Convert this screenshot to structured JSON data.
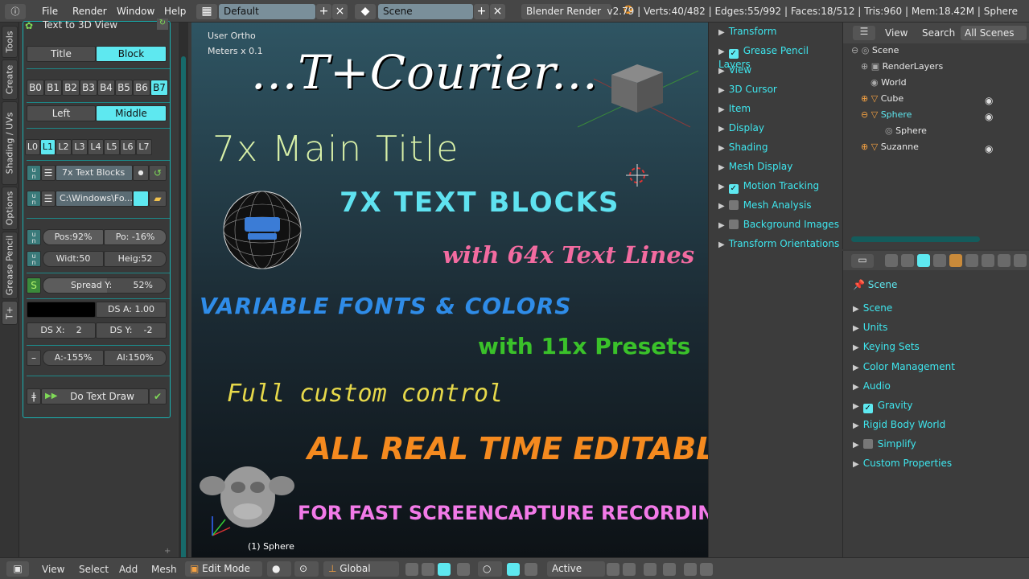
{
  "topbar": {
    "menus": [
      "File",
      "Render",
      "Window",
      "Help"
    ],
    "layout": "Default",
    "scene": "Scene",
    "engine": "Blender Render",
    "status": "v2.79 | Verts:40/482 | Edges:55/992 | Faces:18/512 | Tris:960 | Mem:18.42M | Sphere"
  },
  "tabs": [
    "Tools",
    "Create",
    "Shading / UVs",
    "Options",
    "Grease Pencil",
    "T+"
  ],
  "tools": {
    "header": "Text to 3D View",
    "mode": [
      "Title",
      "Block"
    ],
    "blocks": [
      "B0",
      "B1",
      "B2",
      "B3",
      "B4",
      "B5",
      "B6",
      "B7"
    ],
    "align": [
      "Left",
      "Middle"
    ],
    "lines": [
      "L0",
      "L1",
      "L2",
      "L3",
      "L4",
      "L5",
      "L6",
      "L7"
    ],
    "preset": "7x Text Blocks",
    "path": "C:\\Windows\\Fo...",
    "pos": "Pos:92%",
    "po": "Po: -16%",
    "width": "Widt:50",
    "height": "Heig:52",
    "spread_label": "Spread Y:",
    "spread_value": "52%",
    "ds_a": "DS A: 1.00",
    "ds_x_label": "DS X:",
    "ds_x": "2",
    "ds_y_label": "DS Y:",
    "ds_y": "-2",
    "a": "A:-155%",
    "al": "Al:150%",
    "draw": "Do Text Draw"
  },
  "viewport": {
    "info1": "User Ortho",
    "info2": "Meters x 0.1",
    "title": "...T+Courier...",
    "line1": "7x Main Title",
    "line2": "7X TEXT BLOCKS",
    "line3": "with 64x Text Lines",
    "line4": "VARIABLE FONTS & COLORS",
    "line5": "with 11x Presets",
    "line6": "Full custom control",
    "line7": "ALL REAL TIME EDITABLE",
    "line8": "FOR FAST SCREENCAPTURE RECORDING",
    "object": "(1) Sphere"
  },
  "properties": [
    {
      "label": "Transform",
      "check": null
    },
    {
      "label": "Grease Pencil Layers",
      "check": true
    },
    {
      "label": "View",
      "check": null
    },
    {
      "label": "3D Cursor",
      "check": null
    },
    {
      "label": "Item",
      "check": null
    },
    {
      "label": "Display",
      "check": null
    },
    {
      "label": "Shading",
      "check": null
    },
    {
      "label": "Mesh Display",
      "check": null
    },
    {
      "label": "Motion Tracking",
      "check": true
    },
    {
      "label": "Mesh Analysis",
      "check": false
    },
    {
      "label": "Background Images",
      "check": false
    },
    {
      "label": "Transform Orientations",
      "check": null
    }
  ],
  "outliner": {
    "tabs": [
      "View",
      "Search",
      "All Scenes"
    ],
    "items": [
      "Scene",
      "RenderLayers",
      "World",
      "Cube",
      "Sphere",
      "Sphere",
      "Suzanne"
    ]
  },
  "scene_props": {
    "crumb": "Scene",
    "panels": [
      {
        "label": "Scene",
        "check": null
      },
      {
        "label": "Units",
        "check": null
      },
      {
        "label": "Keying Sets",
        "check": null
      },
      {
        "label": "Color Management",
        "check": null
      },
      {
        "label": "Audio",
        "check": null
      },
      {
        "label": "Gravity",
        "check": true
      },
      {
        "label": "Rigid Body World",
        "check": null
      },
      {
        "label": "Simplify",
        "check": false
      },
      {
        "label": "Custom Properties",
        "check": null
      }
    ]
  },
  "bottombar": {
    "menus": [
      "View",
      "Select",
      "Add",
      "Mesh"
    ],
    "mode": "Edit Mode",
    "orientation": "Global",
    "pivot": "Active"
  }
}
